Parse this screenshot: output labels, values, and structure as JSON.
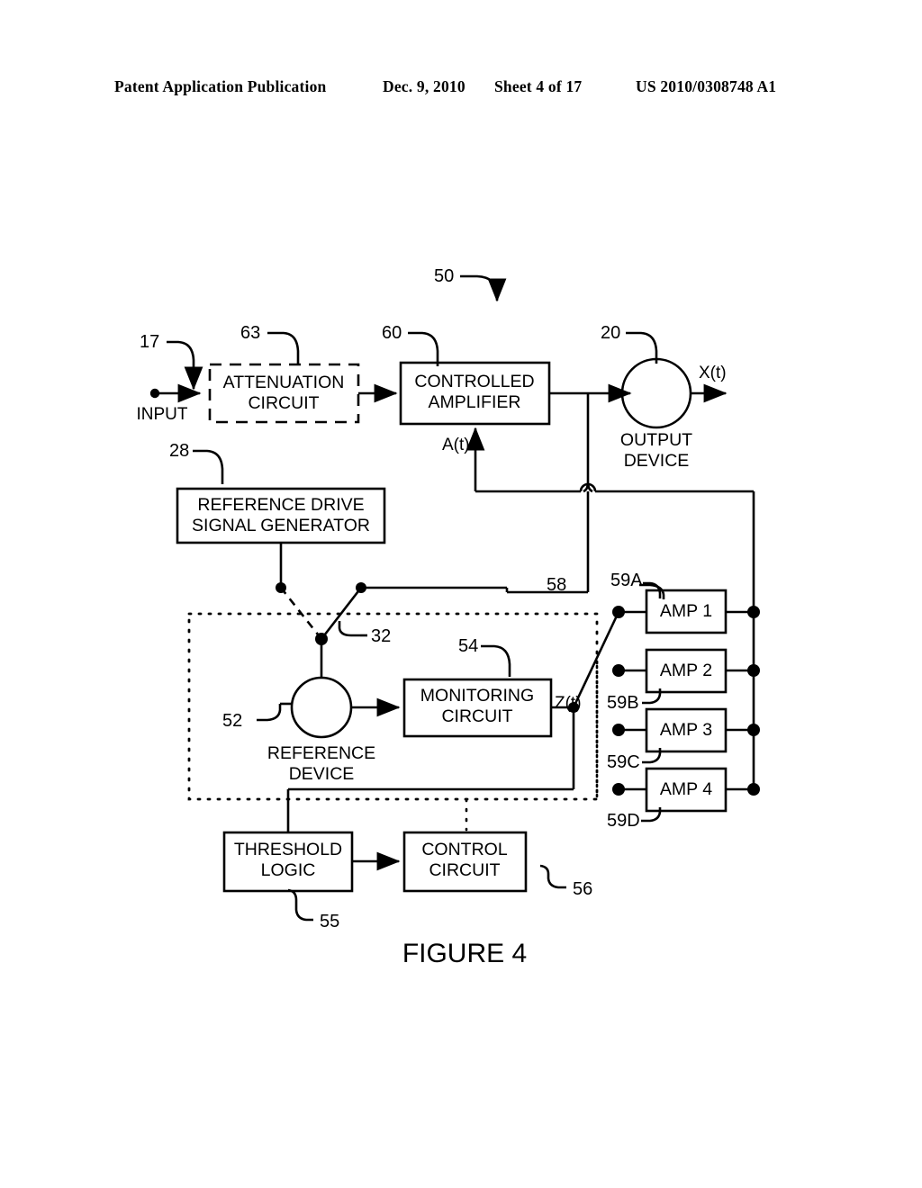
{
  "header": {
    "publication": "Patent Application Publication",
    "date": "Dec. 9, 2010",
    "sheet": "Sheet 4 of 17",
    "patent_number": "US 2010/0308748 A1"
  },
  "figure": {
    "caption": "FIGURE 4",
    "system_ref": "50"
  },
  "blocks": {
    "attenuation_circuit": {
      "label": "ATTENUATION\nCIRCUIT",
      "line1": "ATTENUATION",
      "line2": "CIRCUIT",
      "ref": "63",
      "style": "dashed"
    },
    "controlled_amplifier": {
      "line1": "CONTROLLED",
      "line2": "AMPLIFIER",
      "ref": "60",
      "style": "solid"
    },
    "output_device": {
      "line1": "OUTPUT",
      "line2": "DEVICE",
      "ref": "20",
      "style": "circle"
    },
    "reference_drive_signal_generator": {
      "line1": "REFERENCE DRIVE",
      "line2": "SIGNAL GENERATOR",
      "ref": "28",
      "style": "solid"
    },
    "reference_device": {
      "line1": "REFERENCE",
      "line2": "DEVICE",
      "ref": "52",
      "style": "circle"
    },
    "monitoring_circuit": {
      "line1": "MONITORING",
      "line2": "CIRCUIT",
      "ref": "54",
      "style": "solid"
    },
    "threshold_logic": {
      "line1": "THRESHOLD",
      "line2": "LOGIC",
      "ref": "55",
      "style": "solid"
    },
    "control_circuit": {
      "line1": "CONTROL",
      "line2": "CIRCUIT",
      "ref": "56",
      "style": "solid"
    }
  },
  "amplifiers": [
    {
      "label": "AMP 1",
      "ref": "59A"
    },
    {
      "label": "AMP 2",
      "ref": "59B"
    },
    {
      "label": "AMP 3",
      "ref": "59C"
    },
    {
      "label": "AMP 4",
      "ref": "59D"
    }
  ],
  "switches": {
    "source_select": {
      "ref": "32"
    },
    "amp_select": {
      "ref": "58"
    }
  },
  "signals": {
    "input": {
      "label": "INPUT",
      "ref": "17"
    },
    "output": {
      "label": "X(t)"
    },
    "gain_control": {
      "label": "A(t)"
    },
    "monitor_output": {
      "label": "Z(t)"
    }
  }
}
